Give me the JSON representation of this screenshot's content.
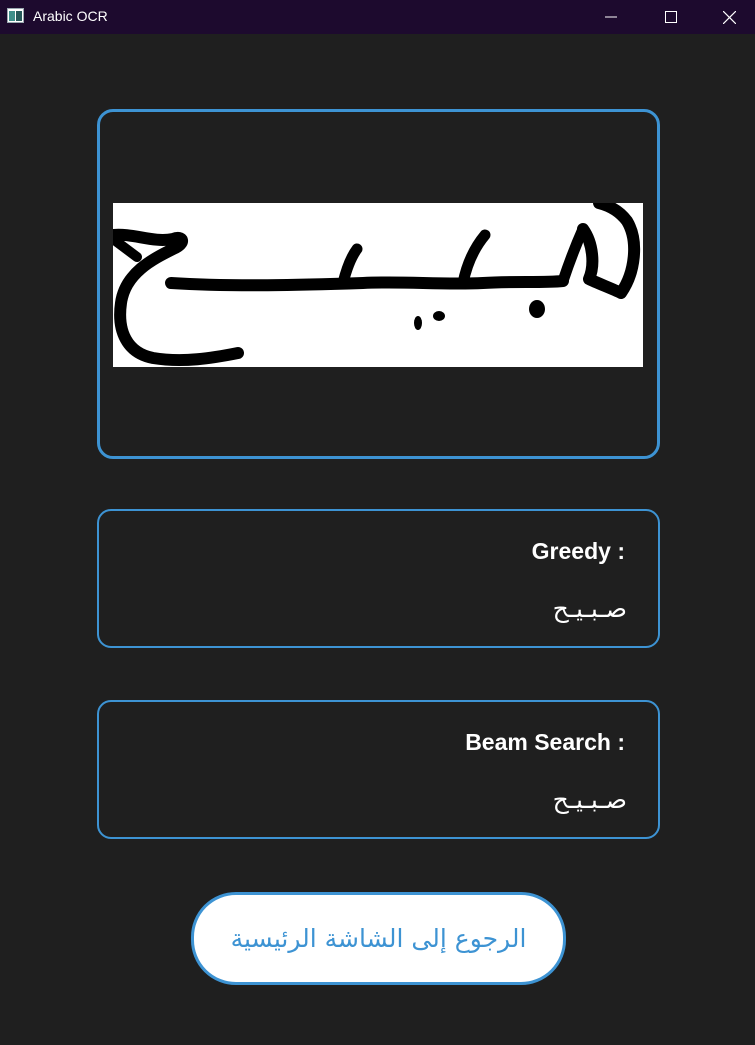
{
  "window": {
    "title": "Arabic OCR",
    "icon": "app-window-icon",
    "controls": [
      "minimize-icon",
      "maximize-icon",
      "close-icon"
    ]
  },
  "input_image": {
    "content": "handwritten Arabic word image"
  },
  "greedy": {
    "label": "Greedy :",
    "result": "صـبـيـح"
  },
  "beam_search": {
    "label": "Beam Search :",
    "result": "صـبـيـح"
  },
  "back_button": {
    "label": "الرجوع إلى الشاشة الرئيسية"
  },
  "colors": {
    "background": "#1f1f1f",
    "titlebar": "#1d0a2e",
    "accent": "#3d93d3",
    "text": "#ffffff",
    "button_bg": "#ffffff"
  }
}
